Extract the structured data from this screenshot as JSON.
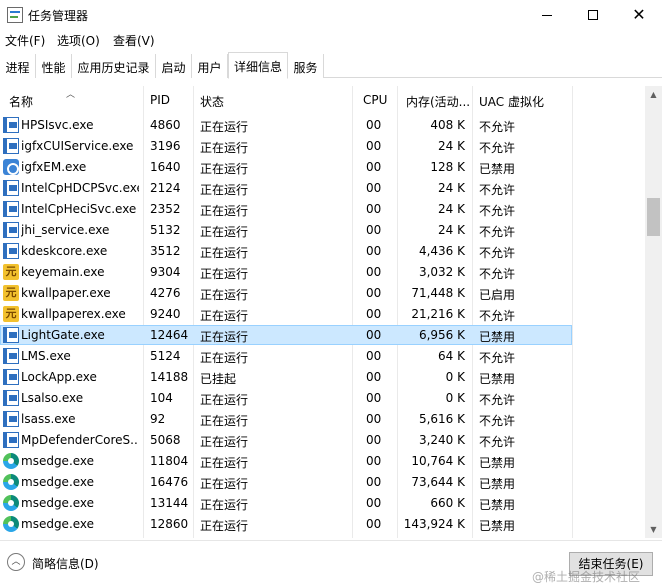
{
  "window": {
    "title": "任务管理器",
    "minimize_icon": "minimize-icon",
    "maximize_icon": "maximize-icon",
    "close_icon": "close-icon"
  },
  "menu": [
    "文件(F)",
    "选项(O)",
    "查看(V)"
  ],
  "tabs": [
    "进程",
    "性能",
    "应用历史记录",
    "启动",
    "用户",
    "详细信息",
    "服务"
  ],
  "active_tab": "详细信息",
  "columns": {
    "name": "名称",
    "pid": "PID",
    "status": "状态",
    "cpu": "CPU",
    "memory": "内存(活动...",
    "uac": "UAC 虚拟化"
  },
  "sort_icon": "sort-ascending-icon",
  "rows": [
    {
      "icon": "window-icon",
      "name": "HPSIsvc.exe",
      "pid": "4860",
      "status": "正在运行",
      "cpu": "00",
      "memory": "408 K",
      "uac": "不允许"
    },
    {
      "icon": "window-icon",
      "name": "igfxCUIService.exe",
      "pid": "3196",
      "status": "正在运行",
      "cpu": "00",
      "memory": "24 K",
      "uac": "不允许"
    },
    {
      "icon": "intel-graphics-icon",
      "name": "igfxEM.exe",
      "pid": "1640",
      "status": "正在运行",
      "cpu": "00",
      "memory": "128 K",
      "uac": "已禁用"
    },
    {
      "icon": "window-icon",
      "name": "IntelCpHDCPSvc.exe",
      "pid": "2124",
      "status": "正在运行",
      "cpu": "00",
      "memory": "24 K",
      "uac": "不允许"
    },
    {
      "icon": "window-icon",
      "name": "IntelCpHeciSvc.exe",
      "pid": "2352",
      "status": "正在运行",
      "cpu": "00",
      "memory": "24 K",
      "uac": "不允许"
    },
    {
      "icon": "window-icon",
      "name": "jhi_service.exe",
      "pid": "5132",
      "status": "正在运行",
      "cpu": "00",
      "memory": "24 K",
      "uac": "不允许"
    },
    {
      "icon": "window-icon",
      "name": "kdeskcore.exe",
      "pid": "3512",
      "status": "正在运行",
      "cpu": "00",
      "memory": "4,436 K",
      "uac": "不允许"
    },
    {
      "icon": "yuan-app-icon",
      "name": "keyemain.exe",
      "pid": "9304",
      "status": "正在运行",
      "cpu": "00",
      "memory": "3,032 K",
      "uac": "不允许"
    },
    {
      "icon": "yuan-app-icon",
      "name": "kwallpaper.exe",
      "pid": "4276",
      "status": "正在运行",
      "cpu": "00",
      "memory": "71,448 K",
      "uac": "已启用"
    },
    {
      "icon": "yuan-app-icon",
      "name": "kwallpaperex.exe",
      "pid": "9240",
      "status": "正在运行",
      "cpu": "00",
      "memory": "21,216 K",
      "uac": "不允许"
    },
    {
      "icon": "window-icon",
      "name": "LightGate.exe",
      "pid": "12464",
      "status": "正在运行",
      "cpu": "00",
      "memory": "6,956 K",
      "uac": "已禁用",
      "selected": true
    },
    {
      "icon": "window-icon",
      "name": "LMS.exe",
      "pid": "5124",
      "status": "正在运行",
      "cpu": "00",
      "memory": "64 K",
      "uac": "不允许"
    },
    {
      "icon": "window-icon",
      "name": "LockApp.exe",
      "pid": "14188",
      "status": "已挂起",
      "cpu": "00",
      "memory": "0 K",
      "uac": "已禁用"
    },
    {
      "icon": "window-icon",
      "name": "Lsalso.exe",
      "pid": "104",
      "status": "正在运行",
      "cpu": "00",
      "memory": "0 K",
      "uac": "不允许"
    },
    {
      "icon": "window-icon",
      "name": "lsass.exe",
      "pid": "92",
      "status": "正在运行",
      "cpu": "00",
      "memory": "5,616 K",
      "uac": "不允许"
    },
    {
      "icon": "window-icon",
      "name": "MpDefenderCoreS...",
      "pid": "5068",
      "status": "正在运行",
      "cpu": "00",
      "memory": "3,240 K",
      "uac": "不允许"
    },
    {
      "icon": "edge-icon",
      "name": "msedge.exe",
      "pid": "11804",
      "status": "正在运行",
      "cpu": "00",
      "memory": "10,764 K",
      "uac": "已禁用"
    },
    {
      "icon": "edge-icon",
      "name": "msedge.exe",
      "pid": "16476",
      "status": "正在运行",
      "cpu": "00",
      "memory": "73,644 K",
      "uac": "已禁用"
    },
    {
      "icon": "edge-icon",
      "name": "msedge.exe",
      "pid": "13144",
      "status": "正在运行",
      "cpu": "00",
      "memory": "660 K",
      "uac": "已禁用"
    },
    {
      "icon": "edge-icon",
      "name": "msedge.exe",
      "pid": "12860",
      "status": "正在运行",
      "cpu": "00",
      "memory": "143,924 K",
      "uac": "已禁用"
    }
  ],
  "footer": {
    "less_details_label": "简略信息(D)",
    "less_details_icon": "chevron-up-icon",
    "end_task_label": "结束任务(E)",
    "watermark": "@稀土掘金技术社区"
  },
  "scrollbar": {
    "position": 0.25
  }
}
